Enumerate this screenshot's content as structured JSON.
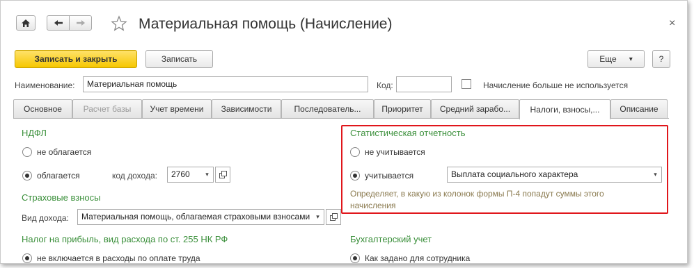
{
  "window": {
    "title": "Материальная помощь (Начисление)",
    "close_symbol": "×"
  },
  "toolbar": {
    "save_close_label": "Записать и закрыть",
    "save_label": "Записать",
    "more_label": "Еще",
    "more_arrow": "▾",
    "help_label": "?"
  },
  "header_fields": {
    "name_label": "Наименование:",
    "name_value": "Материальная помощь",
    "code_label": "Код:",
    "code_value": "",
    "not_used_label": "Начисление больше не используется"
  },
  "tabs": [
    {
      "label": "Основное"
    },
    {
      "label": "Расчет базы"
    },
    {
      "label": "Учет времени"
    },
    {
      "label": "Зависимости"
    },
    {
      "label": "Последователь..."
    },
    {
      "label": "Приоритет"
    },
    {
      "label": "Средний зарабо..."
    },
    {
      "label": "Налоги, взносы,..."
    },
    {
      "label": "Описание"
    }
  ],
  "ndfl": {
    "title": "НДФЛ",
    "option_not_taxed": "не облагается",
    "option_taxed": "облагается",
    "income_code_label": "код дохода:",
    "income_code_value": "2760"
  },
  "insurance": {
    "title": "Страховые взносы",
    "income_type_label": "Вид дохода:",
    "income_type_value": "Материальная помощь, облагаемая страховыми взносами"
  },
  "profit_tax": {
    "title": "Налог на прибыль, вид расхода по ст. 255 НК РФ",
    "option_not_included": "не включается в расходы по оплате труда"
  },
  "statistics": {
    "title": "Статистическая отчетность",
    "option_not_counted": "не учитывается",
    "option_counted": "учитывается",
    "counted_value": "Выплата социального характера",
    "hint": "Определяет, в какую из колонок формы П-4 попадут суммы этого начисления"
  },
  "accounting": {
    "title": "Бухгалтерский учет",
    "option_as_employee": "Как задано для сотрудника"
  },
  "icons": [
    "home-icon",
    "back-arrow-icon",
    "forward-arrow-icon",
    "star-icon",
    "open-icon"
  ]
}
